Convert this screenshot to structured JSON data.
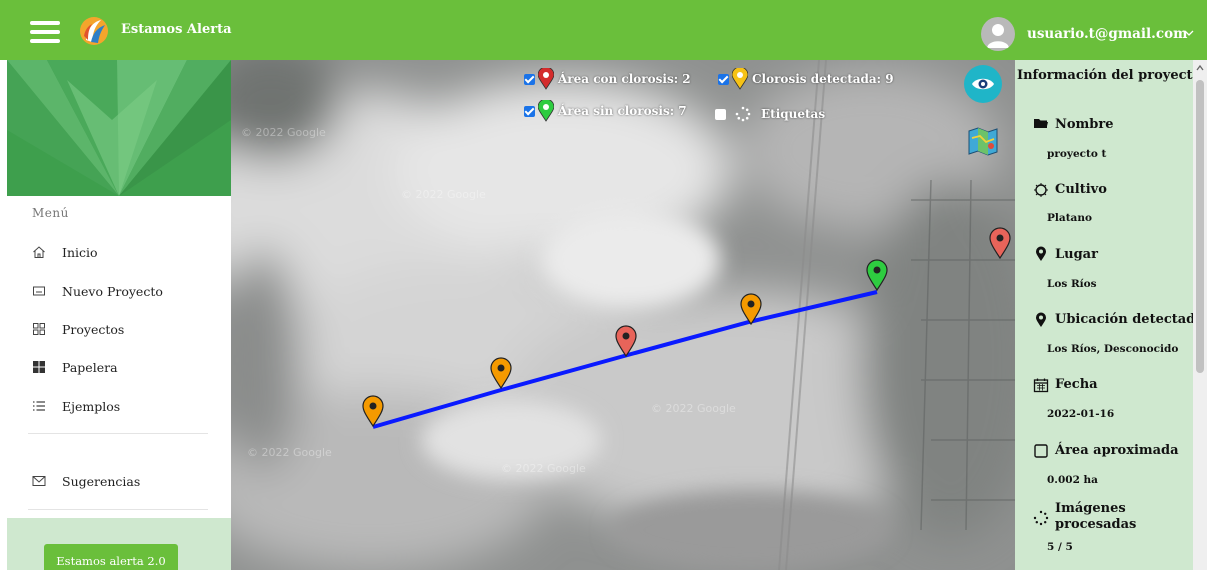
{
  "header": {
    "app_title": "Estamos Alerta",
    "user_email": "usuario.t@gmail.com",
    "brand_color": "#6abf3b"
  },
  "sidebar": {
    "menu_heading": "Menú",
    "items": [
      {
        "label": "Inicio",
        "icon": "home-icon"
      },
      {
        "label": "Nuevo Proyecto",
        "icon": "new-project-icon"
      },
      {
        "label": "Proyectos",
        "icon": "grid-icon"
      },
      {
        "label": "Papelera",
        "icon": "trash-grid-icon"
      },
      {
        "label": "Ejemplos",
        "icon": "list-icon"
      }
    ],
    "suggestions_label": "Sugerencias",
    "bottom_button": "Estamos alerta 2.0"
  },
  "map": {
    "legend": {
      "chlorosis_area": "Área con clorosis: 2",
      "chlorosis_detected": "Clorosis detectada: 9",
      "no_chlorosis_area": "Área sin clorosis: 7",
      "labels": "Etiquetas"
    },
    "watermark": "© 2022 Google",
    "colors": {
      "path": "#0a1aff",
      "marker_orange": "#f59a00",
      "marker_red": "#e8645a",
      "marker_green": "#2ecc40"
    }
  },
  "info": {
    "title": "Información del proyecto",
    "fields": [
      {
        "label": "Nombre",
        "value": "proyecto t",
        "icon": "folder-icon"
      },
      {
        "label": "Cultivo",
        "value": "Platano",
        "icon": "sun-icon"
      },
      {
        "label": "Lugar",
        "value": "Los Ríos",
        "icon": "location-pin-icon"
      },
      {
        "label": "Ubicación detectada",
        "value": "Los Ríos, Desconocido",
        "icon": "location-pin-icon"
      },
      {
        "label": "Fecha",
        "value": "2022-01-16",
        "icon": "calendar-icon"
      },
      {
        "label": "Área aproximada",
        "value": "0.002 ha",
        "icon": "square-icon"
      },
      {
        "label": "Imágenes procesadas",
        "value": "5 / 5",
        "icon": "spinner-icon"
      }
    ]
  }
}
